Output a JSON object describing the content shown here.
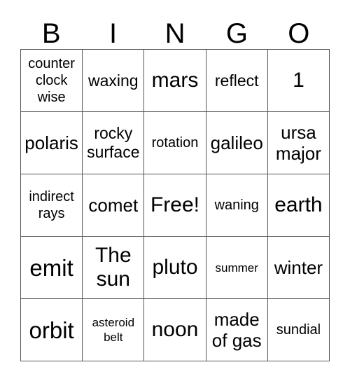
{
  "card": {
    "title_letters": [
      "B",
      "I",
      "N",
      "G",
      "O"
    ],
    "rows": [
      [
        {
          "text": "counter clock wise",
          "size": "s"
        },
        {
          "text": "waxing",
          "size": "m"
        },
        {
          "text": "mars",
          "size": "xl"
        },
        {
          "text": "reflect",
          "size": "m"
        },
        {
          "text": "1",
          "size": "xl"
        }
      ],
      [
        {
          "text": "polaris",
          "size": "l"
        },
        {
          "text": "rocky surface",
          "size": "m"
        },
        {
          "text": "rotation",
          "size": "s"
        },
        {
          "text": "galileo",
          "size": "l"
        },
        {
          "text": "ursa major",
          "size": "l"
        }
      ],
      [
        {
          "text": "indirect rays",
          "size": "s"
        },
        {
          "text": "comet",
          "size": "l"
        },
        {
          "text": "Free!",
          "size": "xl"
        },
        {
          "text": "waning",
          "size": "s"
        },
        {
          "text": "earth",
          "size": "xl"
        }
      ],
      [
        {
          "text": "emit",
          "size": "xxl"
        },
        {
          "text": "The sun",
          "size": "xl"
        },
        {
          "text": "pluto",
          "size": "xl"
        },
        {
          "text": "summer",
          "size": "xs"
        },
        {
          "text": "winter",
          "size": "l"
        }
      ],
      [
        {
          "text": "orbit",
          "size": "xxl"
        },
        {
          "text": "asteroid belt",
          "size": "xs"
        },
        {
          "text": "noon",
          "size": "xl"
        },
        {
          "text": "made of gas",
          "size": "l"
        },
        {
          "text": "sundial",
          "size": "s"
        }
      ]
    ]
  },
  "colors": {
    "grid_line": "#555555",
    "text": "#000000",
    "background": "#ffffff"
  }
}
